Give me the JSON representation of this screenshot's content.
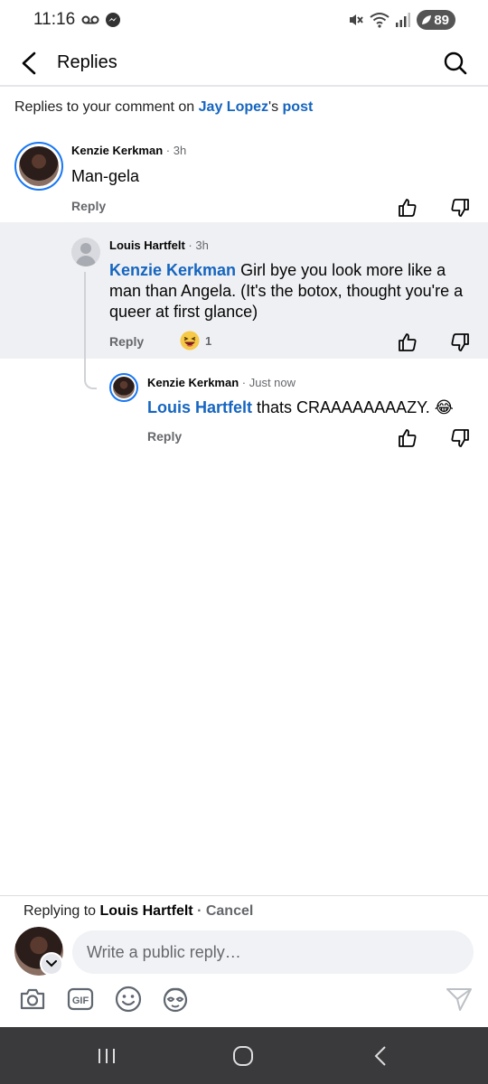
{
  "status": {
    "time": "11:16",
    "battery": "89",
    "network": "6"
  },
  "header": {
    "title": "Replies"
  },
  "context": {
    "prefix": "Replies to your comment on ",
    "author": "Jay Lopez",
    "possessive": "'s ",
    "post": "post"
  },
  "comments": [
    {
      "name": "Kenzie Kerkman",
      "time": " · 3h",
      "text": "Man-gela",
      "reply_label": "Reply"
    },
    {
      "name": "Louis Hartfelt",
      "time": " · 3h",
      "mention": "Kenzie Kerkman",
      "text": " Girl bye you look more like a man than Angela. (It's the botox, thought you're a queer at first glance)",
      "reply_label": "Reply",
      "reaction_count": "1"
    },
    {
      "name": "Kenzie Kerkman",
      "time": " · Just now",
      "mention": "Louis Hartfelt",
      "text": " thats CRAAAAAAAAZY. 😂",
      "reply_label": "Reply"
    }
  ],
  "composer": {
    "replying_prefix": "Replying to ",
    "replying_name": "Louis Hartfelt",
    "separator": " · ",
    "cancel_label": "Cancel",
    "placeholder": "Write a public reply…"
  },
  "colors": {
    "link": "#1565c0",
    "accent_ring": "#1877f2",
    "highlight_bg": "#eff0f3",
    "navbar": "#3a3a3c"
  }
}
